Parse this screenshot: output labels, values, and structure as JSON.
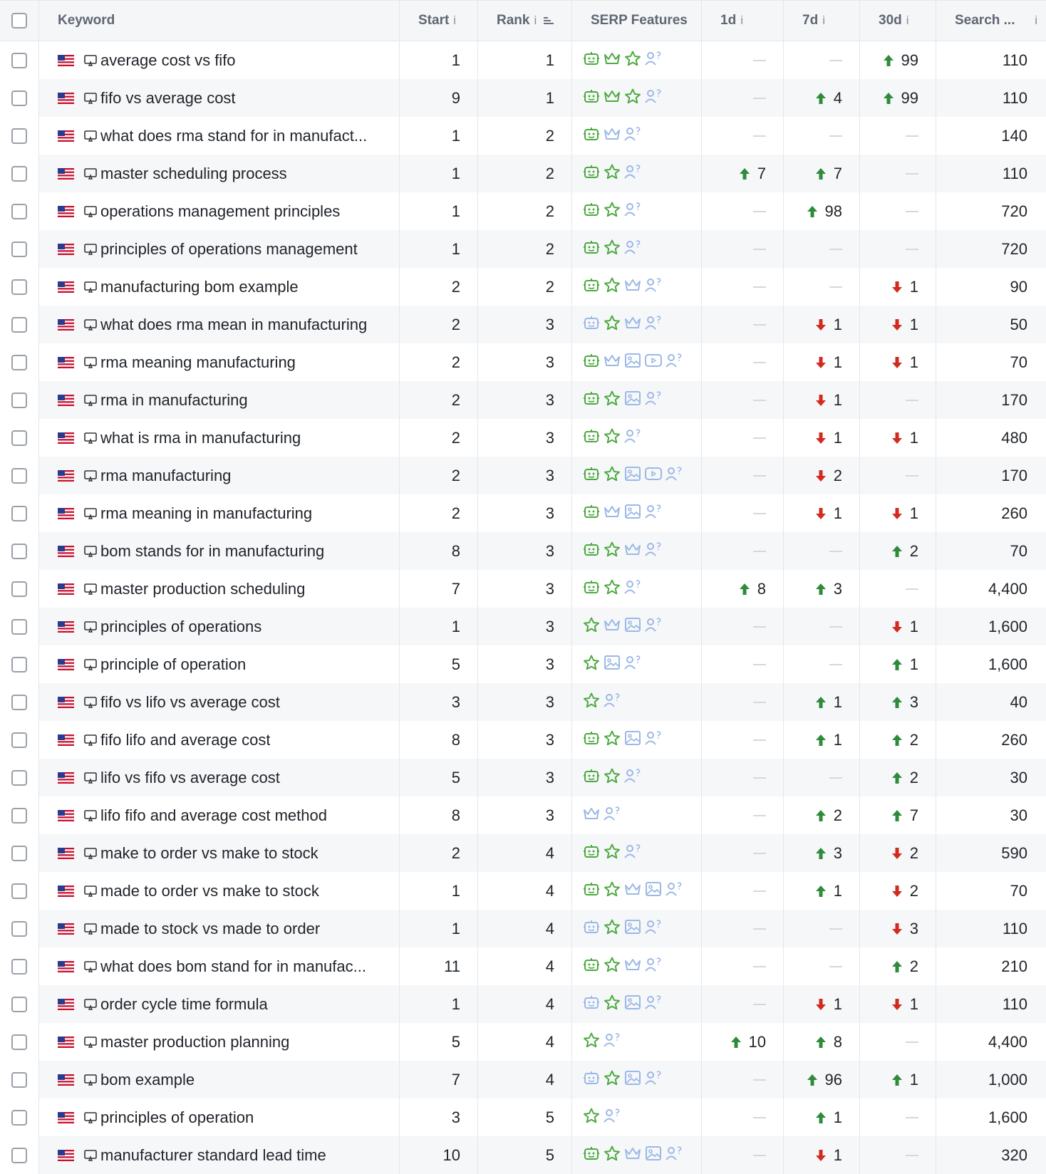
{
  "colors": {
    "up": "#2e8b3a",
    "down": "#d12b1f",
    "feature_active": "#4caa3f",
    "feature_inactive": "#9cb8e6"
  },
  "header": {
    "keyword": "Keyword",
    "start": "Start",
    "rank": "Rank",
    "serp": "SERP Features",
    "d1": "1d",
    "d7": "7d",
    "d30": "30d",
    "search": "Search ...",
    "info_glyph": "i"
  },
  "rows": [
    {
      "keyword": "average cost vs fifo",
      "start": "1",
      "rank": "1",
      "d1": null,
      "d7": null,
      "d30": {
        "dir": "up",
        "value": "99"
      },
      "search": "110",
      "features": [
        [
          "ai",
          1
        ],
        [
          "crown",
          1
        ],
        [
          "star",
          1
        ],
        [
          "people",
          0
        ]
      ]
    },
    {
      "keyword": "fifo vs average cost",
      "start": "9",
      "rank": "1",
      "d1": null,
      "d7": {
        "dir": "up",
        "value": "4"
      },
      "d30": {
        "dir": "up",
        "value": "99"
      },
      "search": "110",
      "features": [
        [
          "ai",
          1
        ],
        [
          "crown",
          1
        ],
        [
          "star",
          1
        ],
        [
          "people",
          0
        ]
      ]
    },
    {
      "keyword": "what does rma stand for in manufact...",
      "start": "1",
      "rank": "2",
      "d1": null,
      "d7": null,
      "d30": null,
      "search": "140",
      "features": [
        [
          "ai",
          1
        ],
        [
          "crown",
          0
        ],
        [
          "people",
          0
        ]
      ]
    },
    {
      "keyword": "master scheduling process",
      "start": "1",
      "rank": "2",
      "d1": {
        "dir": "up",
        "value": "7"
      },
      "d7": {
        "dir": "up",
        "value": "7"
      },
      "d30": null,
      "search": "110",
      "features": [
        [
          "ai",
          1
        ],
        [
          "star",
          1
        ],
        [
          "people",
          0
        ]
      ]
    },
    {
      "keyword": "operations management principles",
      "start": "1",
      "rank": "2",
      "d1": null,
      "d7": {
        "dir": "up",
        "value": "98"
      },
      "d30": null,
      "search": "720",
      "features": [
        [
          "ai",
          1
        ],
        [
          "star",
          1
        ],
        [
          "people",
          0
        ]
      ]
    },
    {
      "keyword": "principles of operations management",
      "start": "1",
      "rank": "2",
      "d1": null,
      "d7": null,
      "d30": null,
      "search": "720",
      "features": [
        [
          "ai",
          1
        ],
        [
          "star",
          1
        ],
        [
          "people",
          0
        ]
      ]
    },
    {
      "keyword": "manufacturing bom example",
      "start": "2",
      "rank": "2",
      "d1": null,
      "d7": null,
      "d30": {
        "dir": "down",
        "value": "1"
      },
      "search": "90",
      "features": [
        [
          "ai",
          1
        ],
        [
          "star",
          1
        ],
        [
          "crown",
          0
        ],
        [
          "people",
          0
        ]
      ]
    },
    {
      "keyword": "what does rma mean in manufacturing",
      "start": "2",
      "rank": "3",
      "d1": null,
      "d7": {
        "dir": "down",
        "value": "1"
      },
      "d30": {
        "dir": "down",
        "value": "1"
      },
      "search": "50",
      "features": [
        [
          "ai",
          0
        ],
        [
          "star",
          1
        ],
        [
          "crown",
          0
        ],
        [
          "people",
          0
        ]
      ]
    },
    {
      "keyword": "rma meaning manufacturing",
      "start": "2",
      "rank": "3",
      "d1": null,
      "d7": {
        "dir": "down",
        "value": "1"
      },
      "d30": {
        "dir": "down",
        "value": "1"
      },
      "search": "70",
      "features": [
        [
          "ai",
          1
        ],
        [
          "crown",
          0
        ],
        [
          "image",
          0
        ],
        [
          "video",
          0
        ],
        [
          "people",
          0
        ]
      ]
    },
    {
      "keyword": "rma in manufacturing",
      "start": "2",
      "rank": "3",
      "d1": null,
      "d7": {
        "dir": "down",
        "value": "1"
      },
      "d30": null,
      "search": "170",
      "features": [
        [
          "ai",
          1
        ],
        [
          "star",
          1
        ],
        [
          "image",
          0
        ],
        [
          "people",
          0
        ]
      ]
    },
    {
      "keyword": "what is rma in manufacturing",
      "start": "2",
      "rank": "3",
      "d1": null,
      "d7": {
        "dir": "down",
        "value": "1"
      },
      "d30": {
        "dir": "down",
        "value": "1"
      },
      "search": "480",
      "features": [
        [
          "ai",
          1
        ],
        [
          "star",
          1
        ],
        [
          "people",
          0
        ]
      ]
    },
    {
      "keyword": "rma manufacturing",
      "start": "2",
      "rank": "3",
      "d1": null,
      "d7": {
        "dir": "down",
        "value": "2"
      },
      "d30": null,
      "search": "170",
      "features": [
        [
          "ai",
          1
        ],
        [
          "star",
          1
        ],
        [
          "image",
          0
        ],
        [
          "video",
          0
        ],
        [
          "people",
          0
        ]
      ]
    },
    {
      "keyword": "rma meaning in manufacturing",
      "start": "2",
      "rank": "3",
      "d1": null,
      "d7": {
        "dir": "down",
        "value": "1"
      },
      "d30": {
        "dir": "down",
        "value": "1"
      },
      "search": "260",
      "features": [
        [
          "ai",
          1
        ],
        [
          "crown",
          0
        ],
        [
          "image",
          0
        ],
        [
          "people",
          0
        ]
      ]
    },
    {
      "keyword": "bom stands for in manufacturing",
      "start": "8",
      "rank": "3",
      "d1": null,
      "d7": null,
      "d30": {
        "dir": "up",
        "value": "2"
      },
      "search": "70",
      "features": [
        [
          "ai",
          1
        ],
        [
          "star",
          1
        ],
        [
          "crown",
          0
        ],
        [
          "people",
          0
        ]
      ]
    },
    {
      "keyword": "master production scheduling",
      "start": "7",
      "rank": "3",
      "d1": {
        "dir": "up",
        "value": "8"
      },
      "d7": {
        "dir": "up",
        "value": "3"
      },
      "d30": null,
      "search": "4,400",
      "features": [
        [
          "ai",
          1
        ],
        [
          "star",
          1
        ],
        [
          "people",
          0
        ]
      ]
    },
    {
      "keyword": "principles of operations",
      "start": "1",
      "rank": "3",
      "d1": null,
      "d7": null,
      "d30": {
        "dir": "down",
        "value": "1"
      },
      "search": "1,600",
      "features": [
        [
          "star",
          1
        ],
        [
          "crown",
          0
        ],
        [
          "image",
          0
        ],
        [
          "people",
          0
        ]
      ]
    },
    {
      "keyword": "principle of operation",
      "start": "5",
      "rank": "3",
      "d1": null,
      "d7": null,
      "d30": {
        "dir": "up",
        "value": "1"
      },
      "search": "1,600",
      "features": [
        [
          "star",
          1
        ],
        [
          "image",
          0
        ],
        [
          "people",
          0
        ]
      ]
    },
    {
      "keyword": "fifo vs lifo vs average cost",
      "start": "3",
      "rank": "3",
      "d1": null,
      "d7": {
        "dir": "up",
        "value": "1"
      },
      "d30": {
        "dir": "up",
        "value": "3"
      },
      "search": "40",
      "features": [
        [
          "star",
          1
        ],
        [
          "people",
          0
        ]
      ]
    },
    {
      "keyword": "fifo lifo and average cost",
      "start": "8",
      "rank": "3",
      "d1": null,
      "d7": {
        "dir": "up",
        "value": "1"
      },
      "d30": {
        "dir": "up",
        "value": "2"
      },
      "search": "260",
      "features": [
        [
          "ai",
          1
        ],
        [
          "star",
          1
        ],
        [
          "image",
          0
        ],
        [
          "people",
          0
        ]
      ]
    },
    {
      "keyword": "lifo vs fifo vs average cost",
      "start": "5",
      "rank": "3",
      "d1": null,
      "d7": null,
      "d30": {
        "dir": "up",
        "value": "2"
      },
      "search": "30",
      "features": [
        [
          "ai",
          1
        ],
        [
          "star",
          1
        ],
        [
          "people",
          0
        ]
      ]
    },
    {
      "keyword": "lifo fifo and average cost method",
      "start": "8",
      "rank": "3",
      "d1": null,
      "d7": {
        "dir": "up",
        "value": "2"
      },
      "d30": {
        "dir": "up",
        "value": "7"
      },
      "search": "30",
      "features": [
        [
          "crown",
          0
        ],
        [
          "people",
          0
        ]
      ]
    },
    {
      "keyword": "make to order vs make to stock",
      "start": "2",
      "rank": "4",
      "d1": null,
      "d7": {
        "dir": "up",
        "value": "3"
      },
      "d30": {
        "dir": "down",
        "value": "2"
      },
      "search": "590",
      "features": [
        [
          "ai",
          1
        ],
        [
          "star",
          1
        ],
        [
          "people",
          0
        ]
      ]
    },
    {
      "keyword": "made to order vs make to stock",
      "start": "1",
      "rank": "4",
      "d1": null,
      "d7": {
        "dir": "up",
        "value": "1"
      },
      "d30": {
        "dir": "down",
        "value": "2"
      },
      "search": "70",
      "features": [
        [
          "ai",
          1
        ],
        [
          "star",
          1
        ],
        [
          "crown",
          0
        ],
        [
          "image",
          0
        ],
        [
          "people",
          0
        ]
      ]
    },
    {
      "keyword": "made to stock vs made to order",
      "start": "1",
      "rank": "4",
      "d1": null,
      "d7": null,
      "d30": {
        "dir": "down",
        "value": "3"
      },
      "search": "110",
      "features": [
        [
          "ai",
          0
        ],
        [
          "star",
          1
        ],
        [
          "image",
          0
        ],
        [
          "people",
          0
        ]
      ]
    },
    {
      "keyword": "what does bom stand for in manufac...",
      "start": "11",
      "rank": "4",
      "d1": null,
      "d7": null,
      "d30": {
        "dir": "up",
        "value": "2"
      },
      "search": "210",
      "features": [
        [
          "ai",
          1
        ],
        [
          "star",
          1
        ],
        [
          "crown",
          0
        ],
        [
          "people",
          0
        ]
      ]
    },
    {
      "keyword": "order cycle time formula",
      "start": "1",
      "rank": "4",
      "d1": null,
      "d7": {
        "dir": "down",
        "value": "1"
      },
      "d30": {
        "dir": "down",
        "value": "1"
      },
      "search": "110",
      "features": [
        [
          "ai",
          0
        ],
        [
          "star",
          1
        ],
        [
          "image",
          0
        ],
        [
          "people",
          0
        ]
      ]
    },
    {
      "keyword": "master production planning",
      "start": "5",
      "rank": "4",
      "d1": {
        "dir": "up",
        "value": "10"
      },
      "d7": {
        "dir": "up",
        "value": "8"
      },
      "d30": null,
      "search": "4,400",
      "features": [
        [
          "star",
          1
        ],
        [
          "people",
          0
        ]
      ]
    },
    {
      "keyword": "bom example",
      "start": "7",
      "rank": "4",
      "d1": null,
      "d7": {
        "dir": "up",
        "value": "96"
      },
      "d30": {
        "dir": "up",
        "value": "1"
      },
      "search": "1,000",
      "features": [
        [
          "ai",
          0
        ],
        [
          "star",
          1
        ],
        [
          "image",
          0
        ],
        [
          "people",
          0
        ]
      ]
    },
    {
      "keyword": "principles of operation",
      "start": "3",
      "rank": "5",
      "d1": null,
      "d7": {
        "dir": "up",
        "value": "1"
      },
      "d30": null,
      "search": "1,600",
      "features": [
        [
          "star",
          1
        ],
        [
          "people",
          0
        ]
      ]
    },
    {
      "keyword": "manufacturer standard lead time",
      "start": "10",
      "rank": "5",
      "d1": null,
      "d7": {
        "dir": "down",
        "value": "1"
      },
      "d30": null,
      "search": "320",
      "features": [
        [
          "ai",
          1
        ],
        [
          "star",
          1
        ],
        [
          "crown",
          0
        ],
        [
          "image",
          0
        ],
        [
          "people",
          0
        ]
      ]
    }
  ]
}
